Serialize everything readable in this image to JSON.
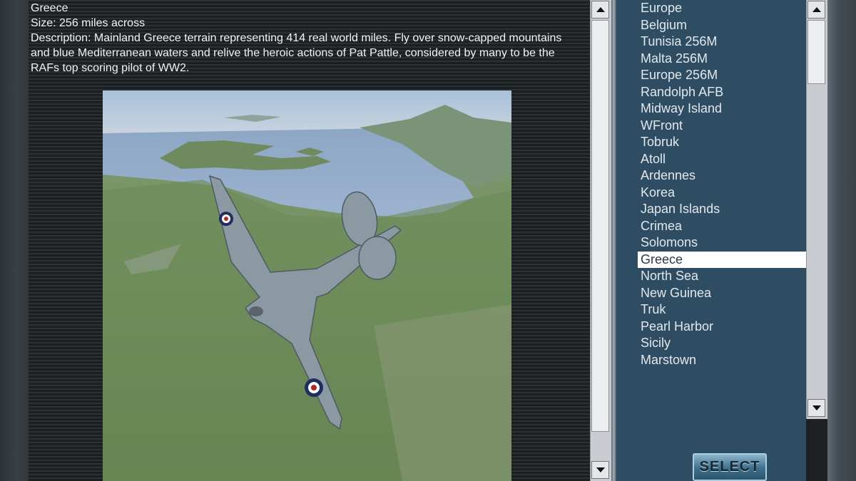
{
  "details": {
    "name": "Greece",
    "size": "Size: 256 miles across",
    "description": "Description: Mainland Greece terrain representing 414 real world miles. Fly over snow-capped mountains and blue Mediterranean waters and relive the heroic actions of Pat Pattle, considered by many to be the RAFs top scoring pilot of WW2."
  },
  "terrain_list": {
    "items": [
      "Europe",
      "Belgium",
      "Tunisia 256M",
      "Malta 256M",
      "Europe 256M",
      "Randolph AFB",
      "Midway Island",
      "WFront",
      "Tobruk",
      "Atoll",
      "Ardennes",
      "Korea",
      "Japan Islands",
      "Crimea",
      "Solomons",
      "Greece",
      "North Sea",
      "New Guinea",
      "Truk",
      "Pearl Harbor",
      "Sicily",
      "Marstown"
    ],
    "selected": "Greece"
  },
  "select_button": {
    "label": "SELECT"
  },
  "icons": {
    "scroll_up": "arrow-up-icon",
    "scroll_down": "arrow-down-icon"
  },
  "colors": {
    "list_background": "#2e4d62",
    "list_text": "#e3e8ec",
    "selection": "#ffffff",
    "button": "#3f6f8a"
  }
}
